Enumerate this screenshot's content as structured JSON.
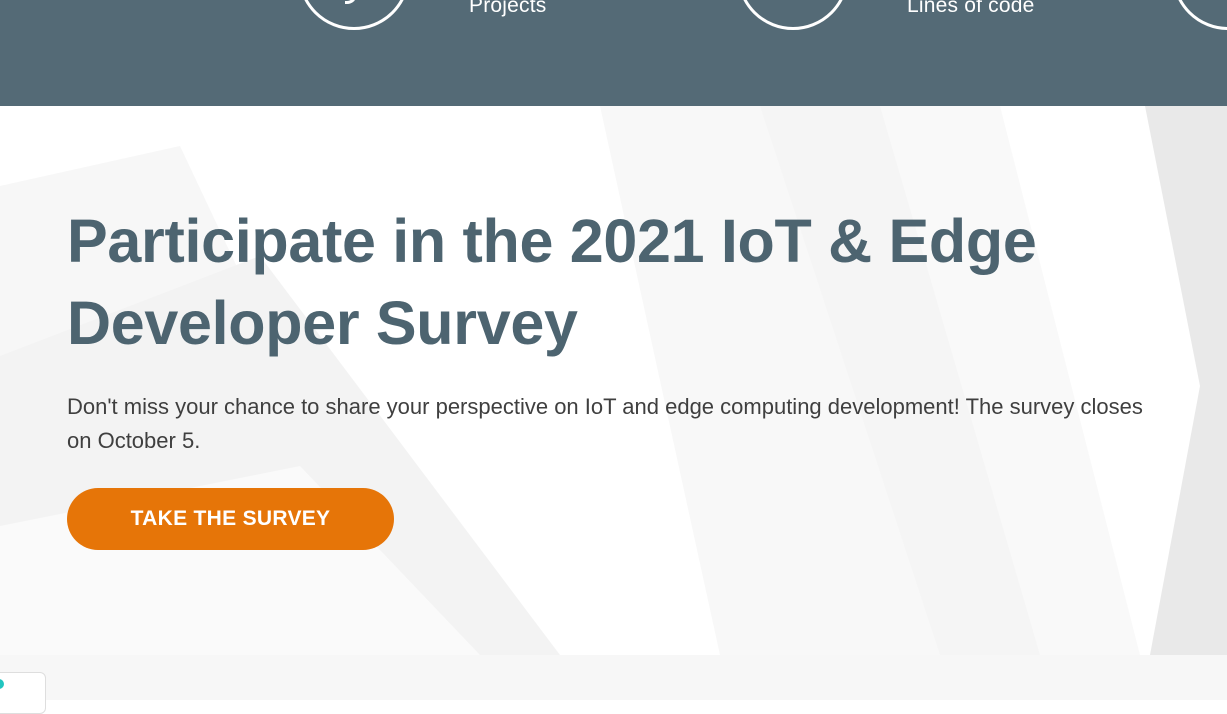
{
  "stats": [
    {
      "label": "Projects"
    },
    {
      "label": "Lines of code"
    }
  ],
  "hero": {
    "title": "Participate in the 2021 IoT & Edge Developer Survey",
    "text": "Don't miss your chance to share your perspective on IoT and edge computing development! The survey closes on October 5.",
    "button_label": "TAKE THE SURVEY"
  },
  "colors": {
    "band": "#546a76",
    "title": "#4d6470",
    "accent": "#e67508"
  }
}
